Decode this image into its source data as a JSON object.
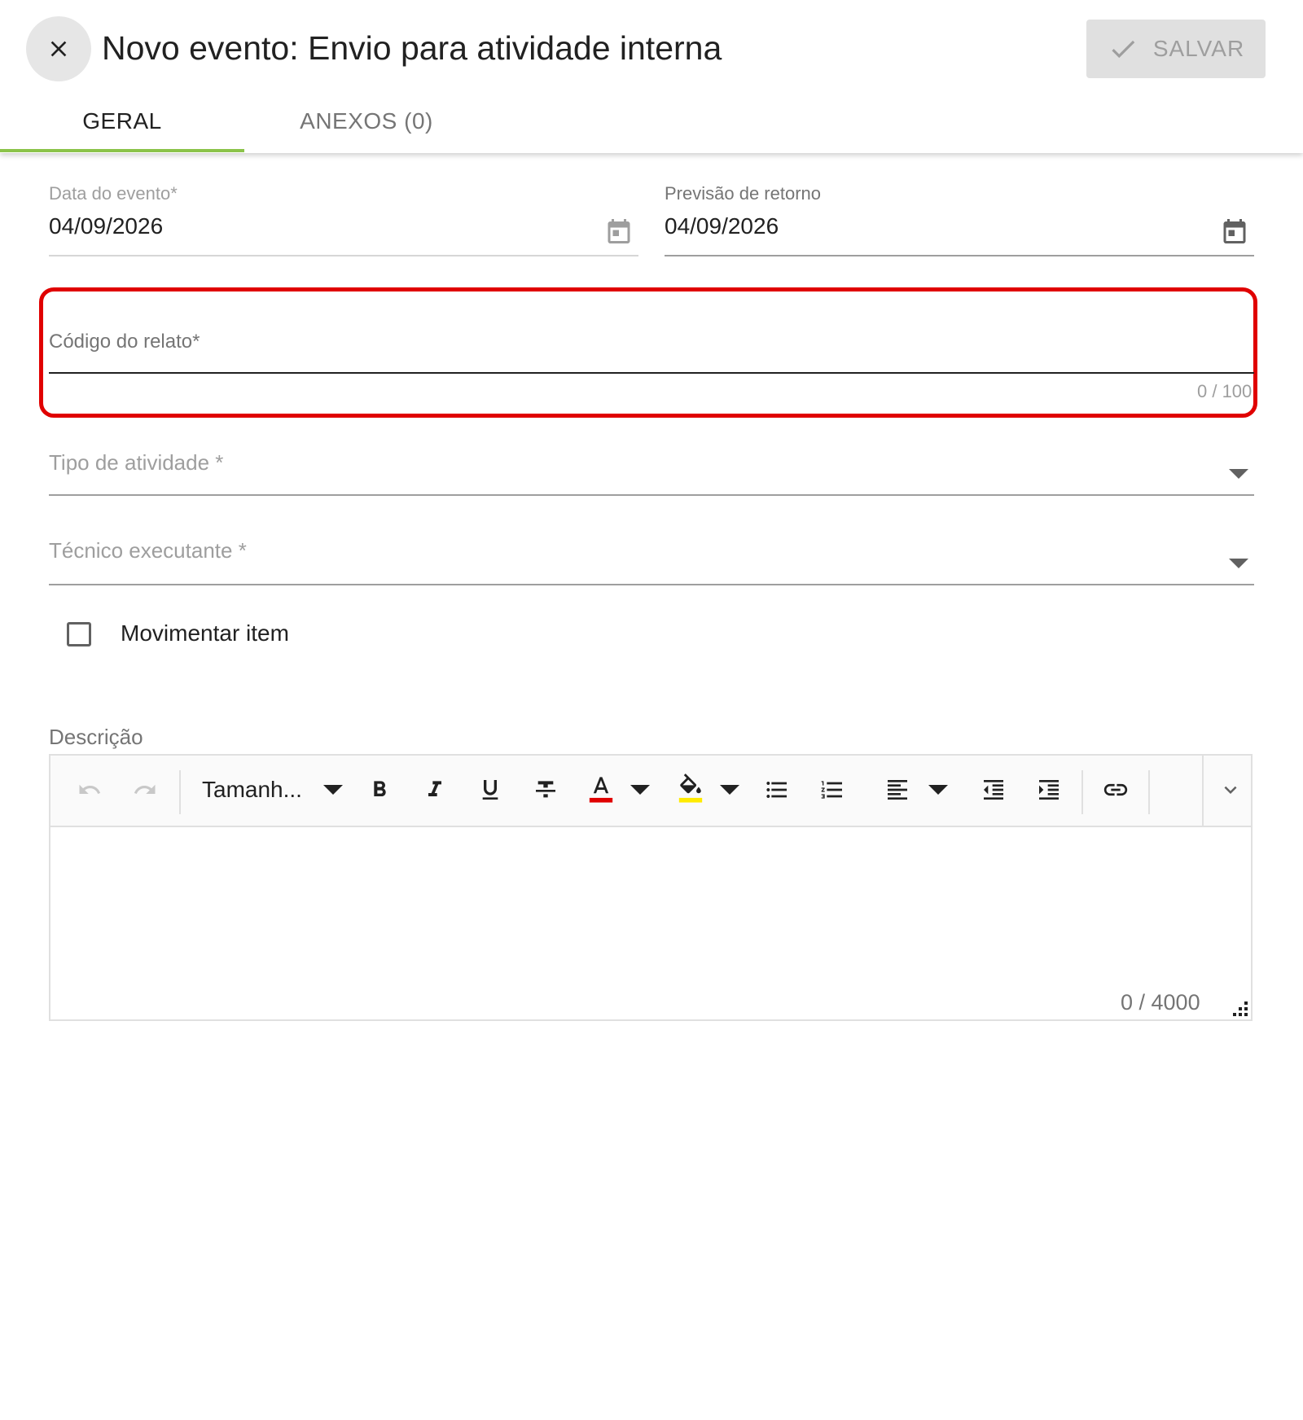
{
  "header": {
    "title": "Novo evento: Envio para atividade interna",
    "save_label": "SALVAR"
  },
  "tabs": [
    {
      "label": "GERAL",
      "active": true
    },
    {
      "label": "ANEXOS (0)",
      "active": false
    }
  ],
  "form": {
    "data_evento": {
      "label": "Data do evento*",
      "value": "04/09/2026"
    },
    "previsao_retorno": {
      "label": "Previsão de retorno",
      "value": "04/09/2026"
    },
    "codigo_relato": {
      "label": "Código do relato*",
      "value": "",
      "counter": "0 / 100"
    },
    "tipo_atividade": {
      "label": "Tipo de atividade *",
      "value": ""
    },
    "tecnico_executante": {
      "label": "Técnico executante *",
      "value": ""
    },
    "movimentar_item": {
      "label": "Movimentar item",
      "checked": false
    },
    "descricao": {
      "label": "Descrição",
      "font_size_label": "Tamanh...",
      "counter": "0 / 4000"
    }
  },
  "toolbar_icons": [
    "undo-icon",
    "redo-icon",
    "bold-icon",
    "italic-icon",
    "underline-icon",
    "strikethrough-icon",
    "font-color-icon",
    "highlight-color-icon",
    "bulleted-list-icon",
    "numbered-list-icon",
    "align-left-icon",
    "outdent-icon",
    "indent-icon",
    "link-icon",
    "expand-toolbar-icon"
  ],
  "colors": {
    "accent_green": "#8bc34a",
    "highlight_red": "#e00000",
    "font_color_bar": "#e00000",
    "highlight_color_bar": "#ffeb00"
  }
}
